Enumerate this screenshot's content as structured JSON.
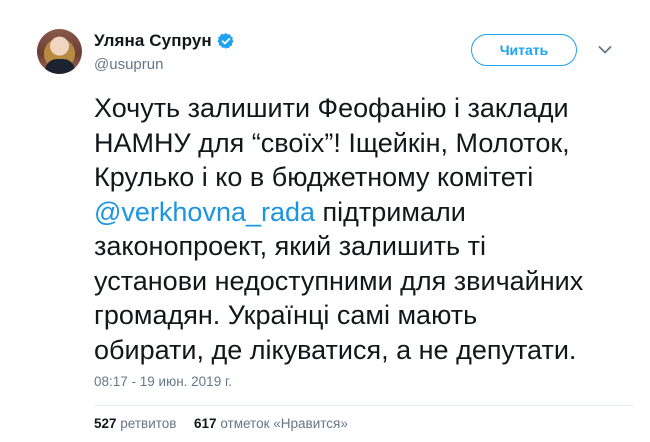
{
  "author": {
    "display_name": "Уляна Супрун",
    "handle": "@usuprun",
    "verified_icon": "verified-badge-icon",
    "avatar_icon": "avatar"
  },
  "actions": {
    "follow_label": "Читать",
    "menu_icon": "chevron-down-icon"
  },
  "tweet": {
    "lines": [
      {
        "text": "Хочуть залишити Феофанію і заклади"
      },
      {
        "text": "НАМНУ для “своїх”! Іщейкін, Молоток,"
      },
      {
        "text": "Крулько і ко в бюджетному комітеті"
      },
      {
        "mention": "@verkhovna_rada",
        "text": " підтримали"
      },
      {
        "text": "законопроект, який залишить ті"
      },
      {
        "text": "установи недоступними для звичайних"
      },
      {
        "text": "громадян. Українці самі мають"
      },
      {
        "text": "обирати, де лікуватися, а не депутати."
      }
    ],
    "timestamp": "08:17 - 19 июн. 2019 г."
  },
  "stats": {
    "retweets_count": "527",
    "retweets_label": "ретвитов",
    "likes_count": "617",
    "likes_label": "отметок «Нравится»"
  },
  "colors": {
    "accent": "#1da1f2",
    "mention": "#1b95e0",
    "text": "#14171a",
    "muted": "#657786",
    "divider": "#e6ecf0"
  }
}
